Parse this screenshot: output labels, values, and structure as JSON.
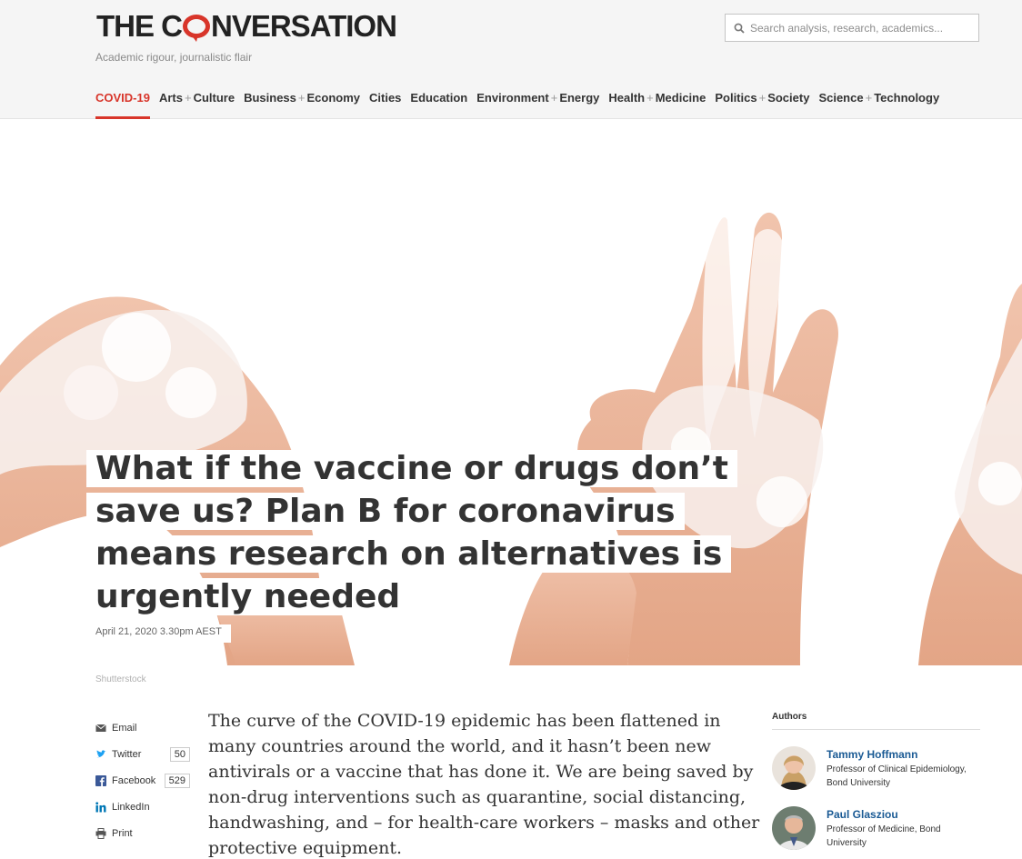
{
  "site": {
    "logo_pre": "THE C",
    "logo_post": "NVERSATION",
    "tagline": "Academic rigour, journalistic flair"
  },
  "search": {
    "placeholder": "Search analysis, research, academics..."
  },
  "nav": {
    "covid": "COVID-19",
    "arts_a": "Arts",
    "arts_b": "Culture",
    "business_a": "Business",
    "business_b": "Economy",
    "cities": "Cities",
    "education": "Education",
    "environment_a": "Environment",
    "environment_b": "Energy",
    "health_a": "Health",
    "health_b": "Medicine",
    "politics_a": "Politics",
    "politics_b": "Society",
    "science_a": "Science",
    "science_b": "Technology",
    "plus": "+"
  },
  "article": {
    "headline": "What if the vaccine or drugs don’t save us? Plan B for coronavirus means research on alternatives is urgently needed",
    "date": "April 21, 2020 3.30pm AEST",
    "image_credit": "Shutterstock",
    "body": "The curve of the COVID-19 epidemic has been flattened in many countries around the world, and it hasn’t been new antivirals or a vaccine that has done it. We are being saved by non-drug interventions such as quarantine, social distancing, handwashing, and – for health-care workers – masks and other protective equipment."
  },
  "share": {
    "email": "Email",
    "twitter": "Twitter",
    "twitter_count": "50",
    "facebook": "Facebook",
    "facebook_count": "529",
    "linkedin": "LinkedIn",
    "print": "Print"
  },
  "authors": {
    "heading": "Authors",
    "list": [
      {
        "name": "Tammy Hoffmann",
        "role": "Professor of Clinical Epidemiology, Bond University"
      },
      {
        "name": "Paul Glasziou",
        "role": "Professor of Medicine, Bond University"
      }
    ]
  },
  "colors": {
    "brand_red": "#d8352a",
    "link_blue": "#1a5a94",
    "header_bg": "#f5f5f5"
  }
}
